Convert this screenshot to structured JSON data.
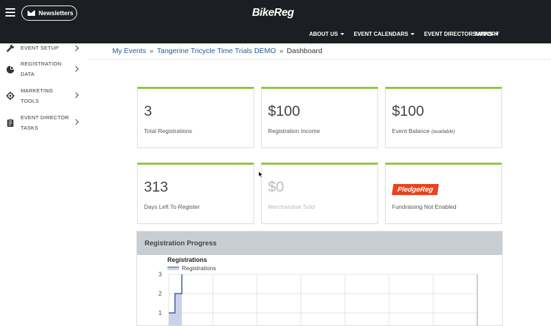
{
  "header": {
    "newsletters_label": "Newsletters",
    "logo_text": "BikeReg",
    "nav": [
      {
        "label": "ABOUT US"
      },
      {
        "label": "EVENT CALENDARS"
      },
      {
        "label": "EVENT DIRECTOR TASKS"
      }
    ],
    "support_label": "SUPPORT"
  },
  "sidebar": {
    "items": [
      {
        "label": "EVENT SETUP",
        "icon": "wrench-icon"
      },
      {
        "line1": "REGISTRATION",
        "line2": "DATA",
        "icon": "pie-chart-icon"
      },
      {
        "line1": "MARKETING",
        "line2": "TOOLS",
        "icon": "target-icon"
      },
      {
        "line1": "EVENT DIRECTOR",
        "line2": "TASKS",
        "icon": "clipboard-icon"
      }
    ]
  },
  "breadcrumb": {
    "my_events": "My Events",
    "sep": "»",
    "event": "Tangerine Tricycle Time Trials DEMO",
    "current": "Dashboard"
  },
  "cards": {
    "total_registrations": {
      "value": "3",
      "label": "Total Registrations"
    },
    "registration_income": {
      "value": "$100",
      "label": "Registration Income"
    },
    "event_balance": {
      "value": "$100",
      "label": "Event Balance",
      "note": "(available)"
    },
    "days_left": {
      "value": "313",
      "label": "Days Left To Register"
    },
    "merchandise": {
      "value": "$0",
      "label": "Merchandise Sold"
    },
    "fundraising": {
      "logo": "PledgeReg",
      "label": "Fundraising Not Enabled"
    }
  },
  "progress": {
    "title": "Registration Progress"
  },
  "chart_data": {
    "type": "area",
    "title": "Registrations",
    "series": [
      {
        "name": "Registrations",
        "values": [
          1,
          1,
          2,
          2,
          3
        ]
      }
    ],
    "y_ticks": [
      "3",
      "2",
      "1"
    ],
    "ylim": [
      0,
      3
    ],
    "colors": {
      "line": "#3a57a8",
      "fill": "#c9d2ea"
    }
  },
  "colors": {
    "topbar": "#1b1e22",
    "accent_green": "#8cc63f",
    "link_blue": "#1f5a9e",
    "pledge_orange": "#e8441f"
  }
}
